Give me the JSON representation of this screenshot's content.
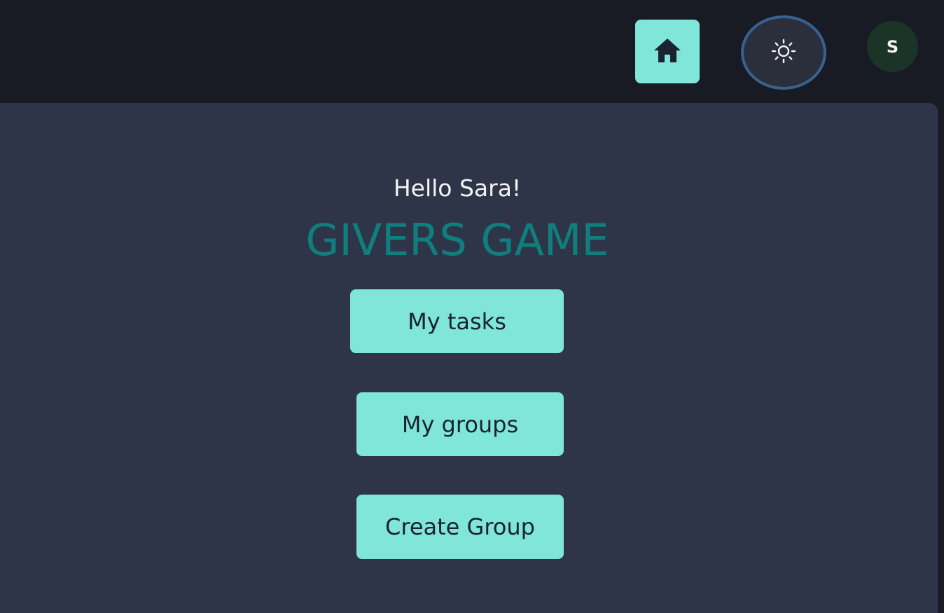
{
  "header": {
    "home_button": {
      "icon": "home-icon"
    },
    "theme_toggle": {
      "icon": "sun-icon"
    },
    "avatar": {
      "initial": "S"
    }
  },
  "main": {
    "greeting": "Hello Sara!",
    "title": "GIVERS GAME",
    "buttons": {
      "my_tasks": "My tasks",
      "my_groups": "My groups",
      "create_group": "Create Group"
    }
  },
  "colors": {
    "accent": "#80e6da",
    "title": "#0f7f7d",
    "background": "#181b24",
    "panel": "#2e3548",
    "avatar_bg": "#1c3327",
    "focus_ring": "#35628f"
  }
}
